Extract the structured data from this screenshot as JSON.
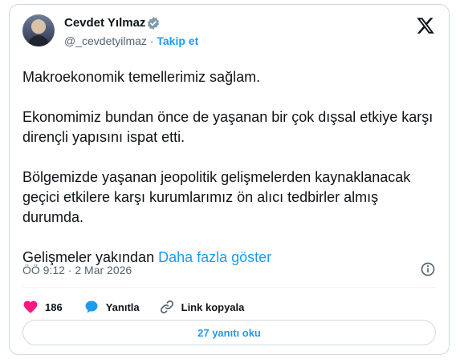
{
  "author": {
    "name": "Cevdet Yılmaz",
    "handle": "@_cevdetyilmaz",
    "separator": "·",
    "follow_label": "Takip et"
  },
  "tweet": {
    "paragraphs": [
      "Makroekonomik temellerimiz sağlam.",
      "Ekonomimiz bundan önce de yaşanan bir çok dışsal etkiye karşı dirençli yapısını ispat etti.",
      "Bölgemizde yaşanan jeopolitik gelişmelerden kaynaklanacak geçici etkilere karşı kurumlarımız ön alıcı tedbirler almış durumda."
    ],
    "truncated_text": "Gelişmeler yakından",
    "show_more_label": "Daha fazla göster",
    "timestamp": "ÖÖ 9:12 · 2 Mar 2026"
  },
  "actions": {
    "like_count": "186",
    "reply_label": "Yanıtla",
    "copy_link_label": "Link kopyala"
  },
  "replies_button_label": "27 yanıtı oku",
  "icons": {
    "verified": "verified-badge-icon",
    "brand": "x-logo-icon",
    "info": "info-icon",
    "like": "heart-icon",
    "reply": "speech-bubble-icon",
    "link": "link-icon"
  },
  "colors": {
    "accent": "#1d9bf0",
    "like": "#f91880",
    "text": "#0f1419",
    "muted": "#536471"
  }
}
